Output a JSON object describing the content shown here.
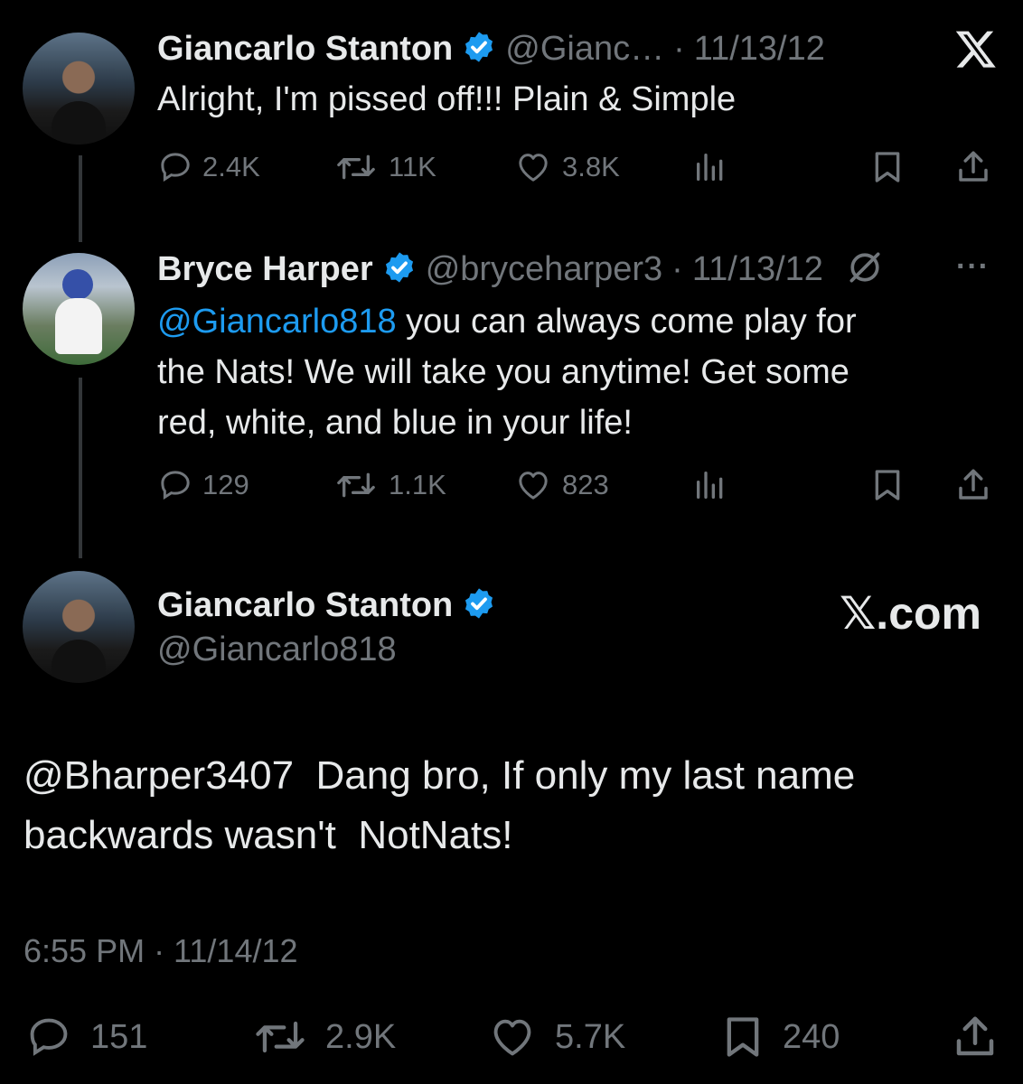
{
  "tweet1": {
    "name": "Giancarlo Stanton",
    "handle": "@Gianc…",
    "separator": "·",
    "date": "11/13/12",
    "text": "Alright, I'm pissed off!!! Plain & Simple",
    "replies": "2.4K",
    "retweets": "11K",
    "likes": "3.8K",
    "top_right_icon": "x-logo-icon"
  },
  "tweet2": {
    "name": "Bryce Harper",
    "handle": "@bryceharper3",
    "separator": "·",
    "date": "11/13/12",
    "mention": "@Giancarlo818",
    "text_line1": " you can always come play for",
    "text_line2": "the Nats! We will take you anytime! Get some",
    "text_line3": "red, white, and blue in your life!",
    "replies": "129",
    "retweets": "1.1K",
    "likes": "823",
    "more_label": "···"
  },
  "tweet3": {
    "name": "Giancarlo Stanton",
    "handle": "@Giancarlo818",
    "site_label": "𝕏.com",
    "text_line1": "@Bharper3407  Dang bro, If only my last name",
    "text_line2": "backwards wasn't  NotNats!",
    "timestamp": "6:55 PM · 11/14/12",
    "replies": "151",
    "retweets": "2.9K",
    "likes": "5.7K",
    "bookmarks": "240"
  },
  "colors": {
    "background": "#000000",
    "text": "#e7e9ea",
    "muted": "#71767b",
    "accent": "#1d9bf0"
  }
}
